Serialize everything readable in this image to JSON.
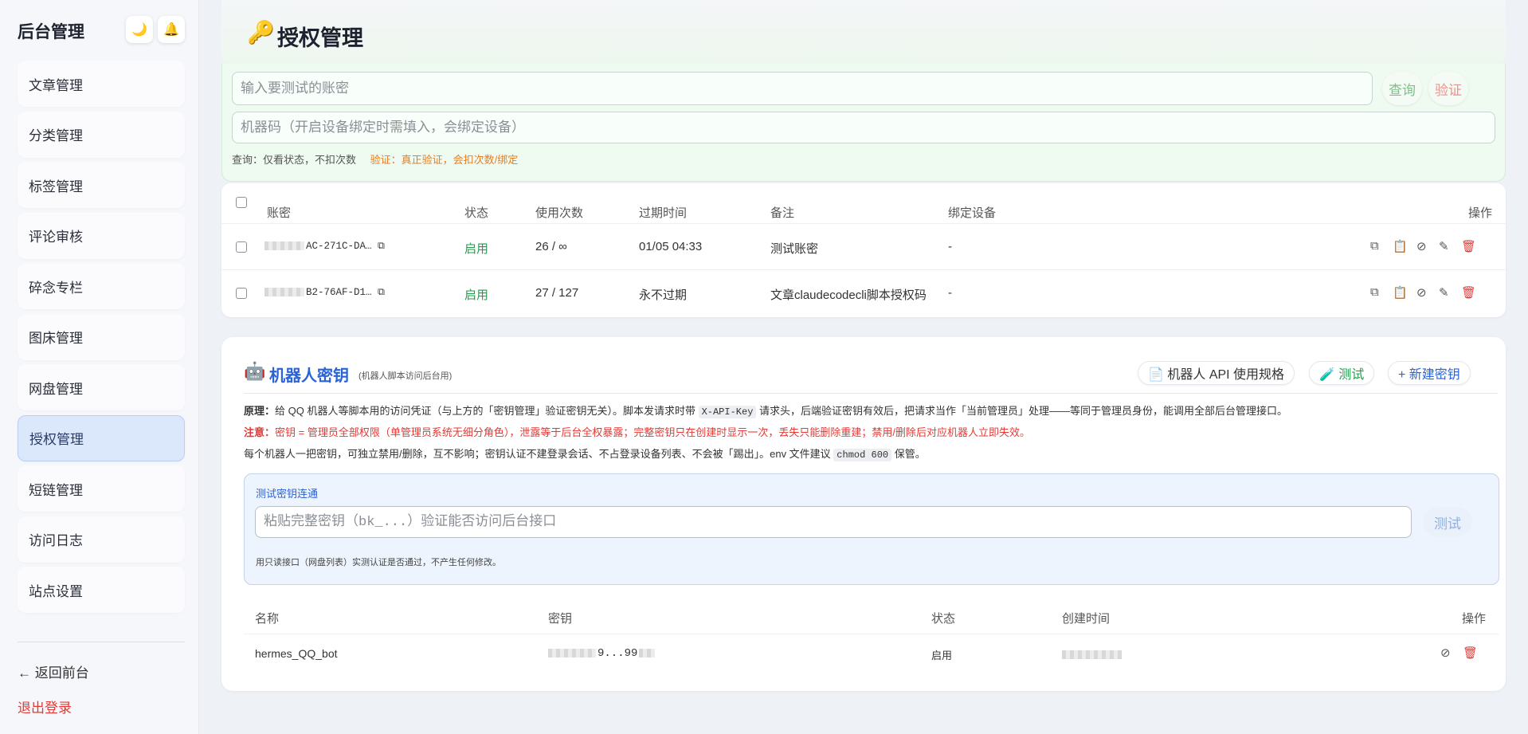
{
  "sidebar": {
    "title": "后台管理",
    "theme_icon": "🌙",
    "bell_icon": "🔔",
    "items": [
      {
        "label": "文章管理"
      },
      {
        "label": "分类管理"
      },
      {
        "label": "标签管理"
      },
      {
        "label": "评论审核"
      },
      {
        "label": "碎念专栏"
      },
      {
        "label": "图床管理"
      },
      {
        "label": "网盘管理"
      },
      {
        "label": "授权管理"
      },
      {
        "label": "短链管理"
      },
      {
        "label": "访问日志"
      },
      {
        "label": "站点设置"
      }
    ],
    "back_label": "← 返回前台",
    "logout_label": "退出登录"
  },
  "header": {
    "title": "授权管理",
    "icon": "🔑"
  },
  "verify": {
    "account_placeholder": "输入要测试的账密",
    "query_label": "查询",
    "verify_label": "验证",
    "machine_placeholder": "机器码（开启设备绑定时需填入，会绑定设备）",
    "hint_query": "查询：仅看状态，不扣次数",
    "hint_verify": "验证：真正验证，会扣次数/绑定"
  },
  "licenses": {
    "columns": {
      "key": "账密",
      "status": "状态",
      "uses": "使用次数",
      "expire": "过期时间",
      "note": "备注",
      "device": "绑定设备",
      "actions": "操作"
    },
    "rows": [
      {
        "key": "AC-271C-DA…",
        "status": "启用",
        "uses": "26 / ∞",
        "expire": "01/05 04:33",
        "note": "测试账密",
        "device": "-"
      },
      {
        "key": "B2-76AF-D1…",
        "status": "启用",
        "uses": "27 / 127",
        "expire": "永不过期",
        "note": "文章claudecodecli脚本授权码",
        "device": "-"
      }
    ],
    "action_icons": {
      "copy": "⧉",
      "clipboard": "📋",
      "disable": "⊘",
      "edit": "✎",
      "delete": "🗑"
    }
  },
  "bot": {
    "icon": "🤖",
    "title": "机器人密钥",
    "subtitle": "(机器人脚本访问后台用)",
    "spec_label": "📄 机器人 API 使用规格",
    "test_label": "🧪 测试",
    "new_label": "+ 新建密钥",
    "desc1_bold": "原理：",
    "desc1_a": "给 QQ 机器人等脚本用的访问凭证（与上方的「密钥管理」验证密钥无关）。脚本发请求时带 ",
    "desc1_code": "X-API-Key",
    "desc1_b": " 请求头，后端验证密钥有效后，把请求当作「当前管理员」处理——等同于管理员身份，能调用全部后台管理接口。",
    "desc2_bold": "注意：",
    "desc2": "密钥 = 管理员全部权限（单管理员系统无细分角色），泄露等于后台全权暴露；完整密钥只在创建时显示一次，丢失只能删除重建；禁用/删除后对应机器人立即失效。",
    "desc3_a": "每个机器人一把密钥，可独立禁用/删除，互不影响；密钥认证不建登录会话、不占登录设备列表、不会被「踢出」。env 文件建议 ",
    "desc3_code": "chmod 600",
    "desc3_b": " 保管。",
    "test_box": {
      "label": "测试密钥连通",
      "placeholder": "粘贴完整密钥（bk_...）验证能否访问后台接口",
      "button": "测试",
      "note": "用只读接口（网盘列表）实测认证是否通过，不产生任何修改。"
    },
    "columns": {
      "name": "名称",
      "key": "密钥",
      "status": "状态",
      "created": "创建时间",
      "actions": "操作"
    },
    "rows": [
      {
        "name": "hermes_QQ_bot",
        "key": "9...99",
        "status": "启用",
        "created": ""
      }
    ]
  },
  "colors": {
    "accent": "#2a63d8",
    "success": "#1e9e4a",
    "danger": "#e53935",
    "warning": "#e67e22"
  }
}
